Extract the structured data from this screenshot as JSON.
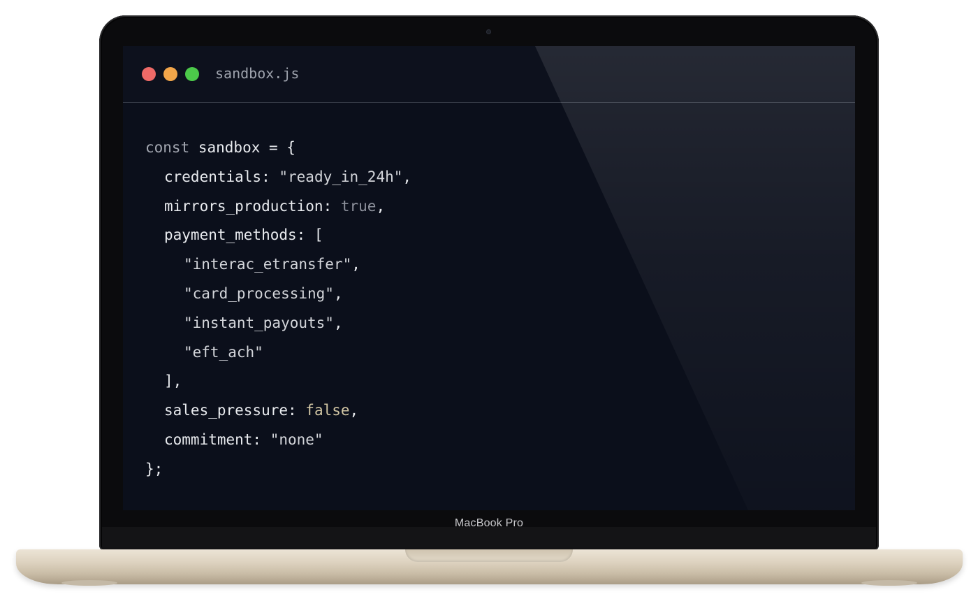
{
  "window": {
    "filename": "sandbox.js",
    "controls": {
      "close_color": "#ee6a67",
      "minimize_color": "#f2a64a",
      "maximize_color": "#4cc94a"
    }
  },
  "device": {
    "label": "MacBook Pro"
  },
  "code": {
    "l1_keyword": "const",
    "l1_rest": " sandbox = {",
    "l2_key": "credentials: ",
    "l2_value": "\"ready_in_24h\"",
    "l2_punct": ",",
    "l3_key": "mirrors_production: ",
    "l3_value": "true",
    "l3_punct": ",",
    "l4_key": "payment_methods: [",
    "l5_value": "\"interac_etransfer\"",
    "l5_punct": ",",
    "l6_value": "\"card_processing\"",
    "l6_punct": ",",
    "l7_value": "\"instant_payouts\"",
    "l7_punct": ",",
    "l8_value": "\"eft_ach\"",
    "l9_text": "],",
    "l10_key": "sales_pressure: ",
    "l10_value": "false",
    "l10_punct": ",",
    "l11_key": "commitment: ",
    "l11_value": "\"none\"",
    "l12_text": "};"
  }
}
